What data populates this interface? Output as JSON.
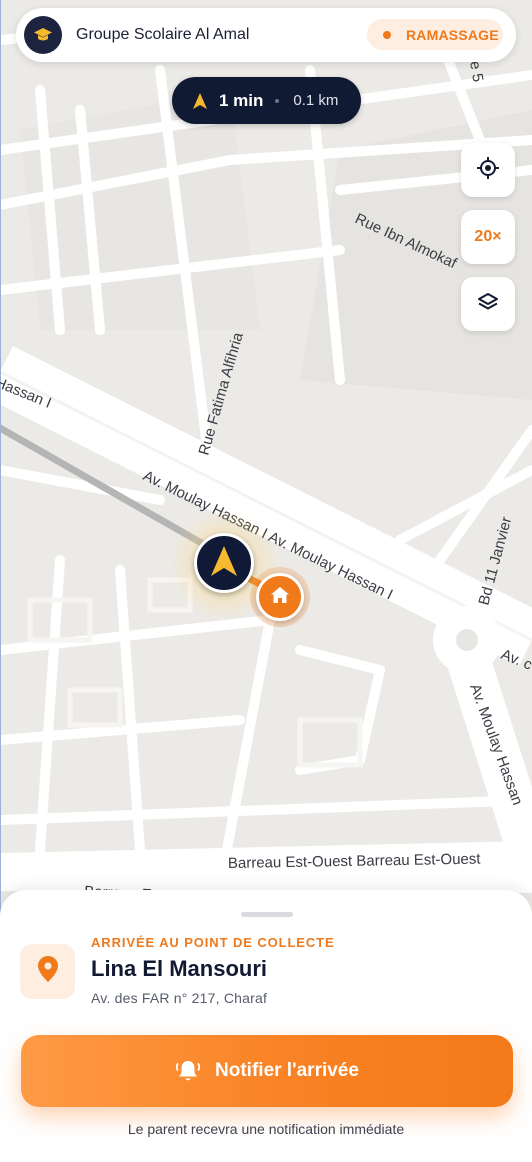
{
  "header": {
    "school_name": "Groupe Scolaire Al Amal",
    "mode_badge": "RAMASSAGE",
    "logo_icon": "graduation-cap-icon"
  },
  "eta": {
    "time": "1 min",
    "distance": "0.1 km",
    "icon": "navigation-arrow-icon"
  },
  "map": {
    "street_labels": {
      "rue_ibn_almokaf": "Rue Ibn Almokaf",
      "rue_fatima": "Rue Fatima Alfihria",
      "hassan_left": "Hassan I",
      "moulay_hassan_main": "Av. Moulay Hassan I Av. Moulay Hassan I",
      "bd_11_janvier": "Bd 11 Janvier",
      "av_right": "Av. c",
      "moulay_hassan_vertical": "Av. Moulay Hassan",
      "barreau": "Barreau Est-Ouest Barreau Est-Ouest",
      "barreau_lower": "Barreau Est-Ouest",
      "top_right": "e 5"
    },
    "controls": {
      "locate_icon": "crosshair-icon",
      "zoom_label": "20×",
      "layers_icon": "layers-icon"
    },
    "markers": {
      "bus": "navigation-arrow-icon",
      "home": "home-icon"
    },
    "colors": {
      "accent": "#f07a1a",
      "navy": "#111a33"
    }
  },
  "sheet": {
    "arrival_label": "ARRIVÉE AU POINT DE COLLECTE",
    "student_name": "Lina El Mansouri",
    "address": "Av. des FAR n° 217, Charaf",
    "notify_button": "Notifier l'arrivée",
    "hint": "Le parent recevra une notification immédiate"
  }
}
